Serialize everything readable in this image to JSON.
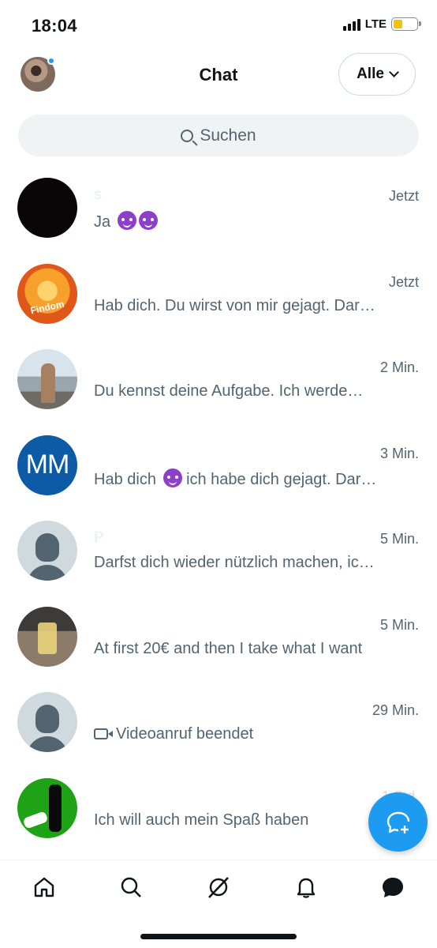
{
  "status_bar": {
    "time": "18:04",
    "network": "LTE"
  },
  "header": {
    "title": "Chat",
    "filter_label": "Alle"
  },
  "search": {
    "placeholder": "Suchen"
  },
  "conversations": [
    {
      "name": "s",
      "time": "Jetzt",
      "message": "Ja",
      "emoji_count": 2,
      "avatar": "black"
    },
    {
      "name": "Findom",
      "time": "Jetzt",
      "message": "Hab dich. Du wirst von mir gejagt. Dar…",
      "avatar_label": "Findom",
      "avatar": "fire"
    },
    {
      "name": "",
      "time": "2 Min.",
      "message": "Du kennst deine Aufgabe. Ich werde…",
      "avatar": "photo"
    },
    {
      "name": "",
      "time": "3 Min.",
      "message_before": "Hab dich",
      "message_after": "ich habe dich gejagt. Dar…",
      "avatar_initials": "MM",
      "avatar": "initials"
    },
    {
      "name": "P",
      "time": "5 Min.",
      "message": "Darfst dich wieder nützlich machen, ic…",
      "avatar": "default"
    },
    {
      "name": "",
      "time": "5 Min.",
      "message": "At first 20€ and then I take what I want",
      "avatar": "photo"
    },
    {
      "name": "",
      "time": "29 Min.",
      "message": "Videoanruf beendet",
      "avatar": "default"
    },
    {
      "name": "",
      "time": "1 Std.",
      "message": "Ich will auch mein Spaß haben",
      "avatar": "green"
    }
  ],
  "colors": {
    "accent": "#1d9bf0",
    "secondary_text": "#536471",
    "search_bg": "#eff3f4",
    "battery": "#f5c400"
  },
  "icons": {
    "fab": "new-message-icon",
    "nav": [
      "home-icon",
      "search-icon",
      "grok-icon",
      "notifications-icon",
      "messages-icon"
    ]
  }
}
